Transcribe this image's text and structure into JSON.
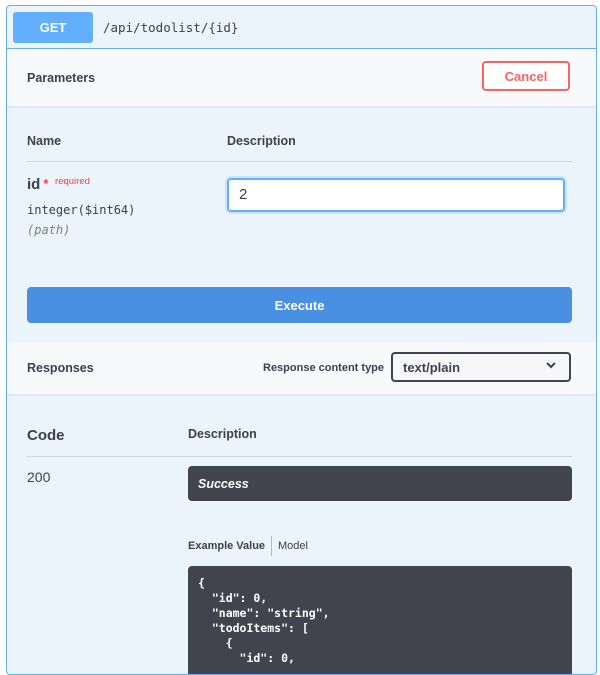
{
  "operation": {
    "method": "GET",
    "path": "/api/todolist/{id}"
  },
  "parameters": {
    "title": "Parameters",
    "cancel_label": "Cancel",
    "col_name": "Name",
    "col_description": "Description",
    "items": [
      {
        "name": "id",
        "required_star": "*",
        "required_label": "required",
        "type": "integer($int64)",
        "in": "(path)",
        "value": "2"
      }
    ]
  },
  "execute_label": "Execute",
  "responses": {
    "title": "Responses",
    "content_type_label": "Response content type",
    "content_type_value": "text/plain",
    "col_code": "Code",
    "col_description": "Description",
    "items": [
      {
        "code": "200",
        "description": "Success",
        "tab_example": "Example Value",
        "tab_model": "Model",
        "example": "{\n  \"id\": 0,\n  \"name\": \"string\",\n  \"todoItems\": [\n    {\n      \"id\": 0,"
      }
    ]
  },
  "colors": {
    "get_method": "#61affe",
    "execute": "#4990e2",
    "cancel": "#ff6060",
    "dark_panel": "#41444e",
    "block_bg": "#ebf3fb"
  },
  "icons": {
    "select_chevron": "chevron-down-icon"
  }
}
